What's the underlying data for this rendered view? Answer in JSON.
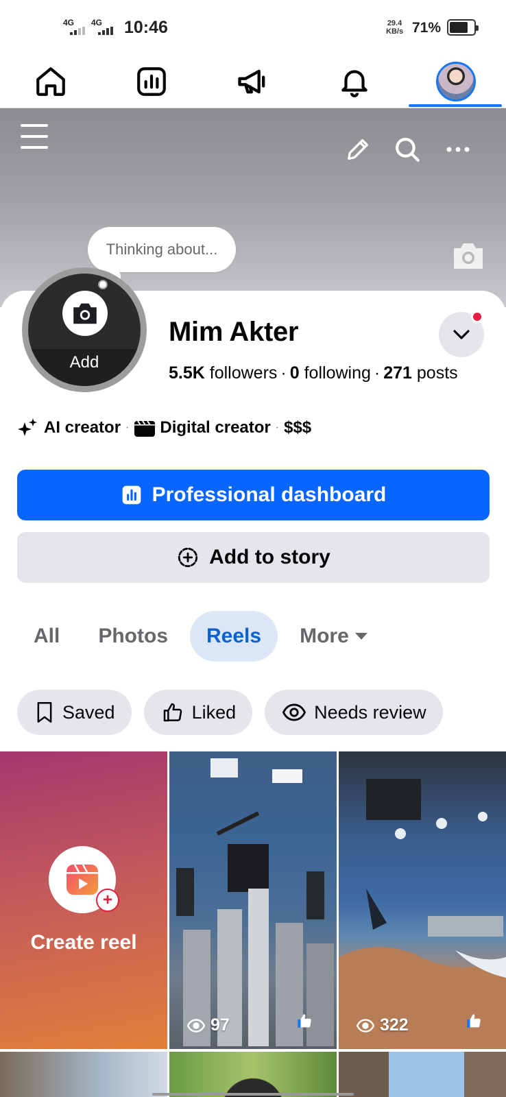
{
  "status_bar": {
    "network1": "4G",
    "network2": "4G",
    "time": "10:46",
    "speed_value": "29.4",
    "speed_unit": "KB/s",
    "battery": "71%",
    "battery_level": 0.71
  },
  "top_nav": {
    "items": [
      "home-icon",
      "dashboard-icon",
      "megaphone-icon",
      "bell-icon",
      "profile-avatar"
    ],
    "active": "profile-avatar"
  },
  "profile": {
    "thought_bubble": "Thinking about...",
    "avatar_add_label": "Add",
    "name": "Mim Akter",
    "followers_count": "5.5K",
    "followers_label": "followers",
    "following_count": "0",
    "following_label": "following",
    "posts_count": "271",
    "posts_label": "posts",
    "creator_tags": [
      "AI creator",
      "Digital creator",
      "$$$"
    ]
  },
  "actions": {
    "dashboard_label": "Professional dashboard",
    "story_label": "Add to story"
  },
  "tabs": {
    "items": [
      "All",
      "Photos",
      "Reels",
      "More"
    ],
    "active": "Reels"
  },
  "filters": {
    "saved": "Saved",
    "liked": "Liked",
    "needs_review": "Needs review"
  },
  "reels": {
    "create_label": "Create reel",
    "items": [
      {
        "views": "97"
      },
      {
        "views": "322"
      }
    ]
  },
  "colors": {
    "accent": "#0866ff",
    "active_tab_bg": "#dbe7f6",
    "active_tab_text": "#0a62d1",
    "notification_dot": "#e41e3f"
  }
}
